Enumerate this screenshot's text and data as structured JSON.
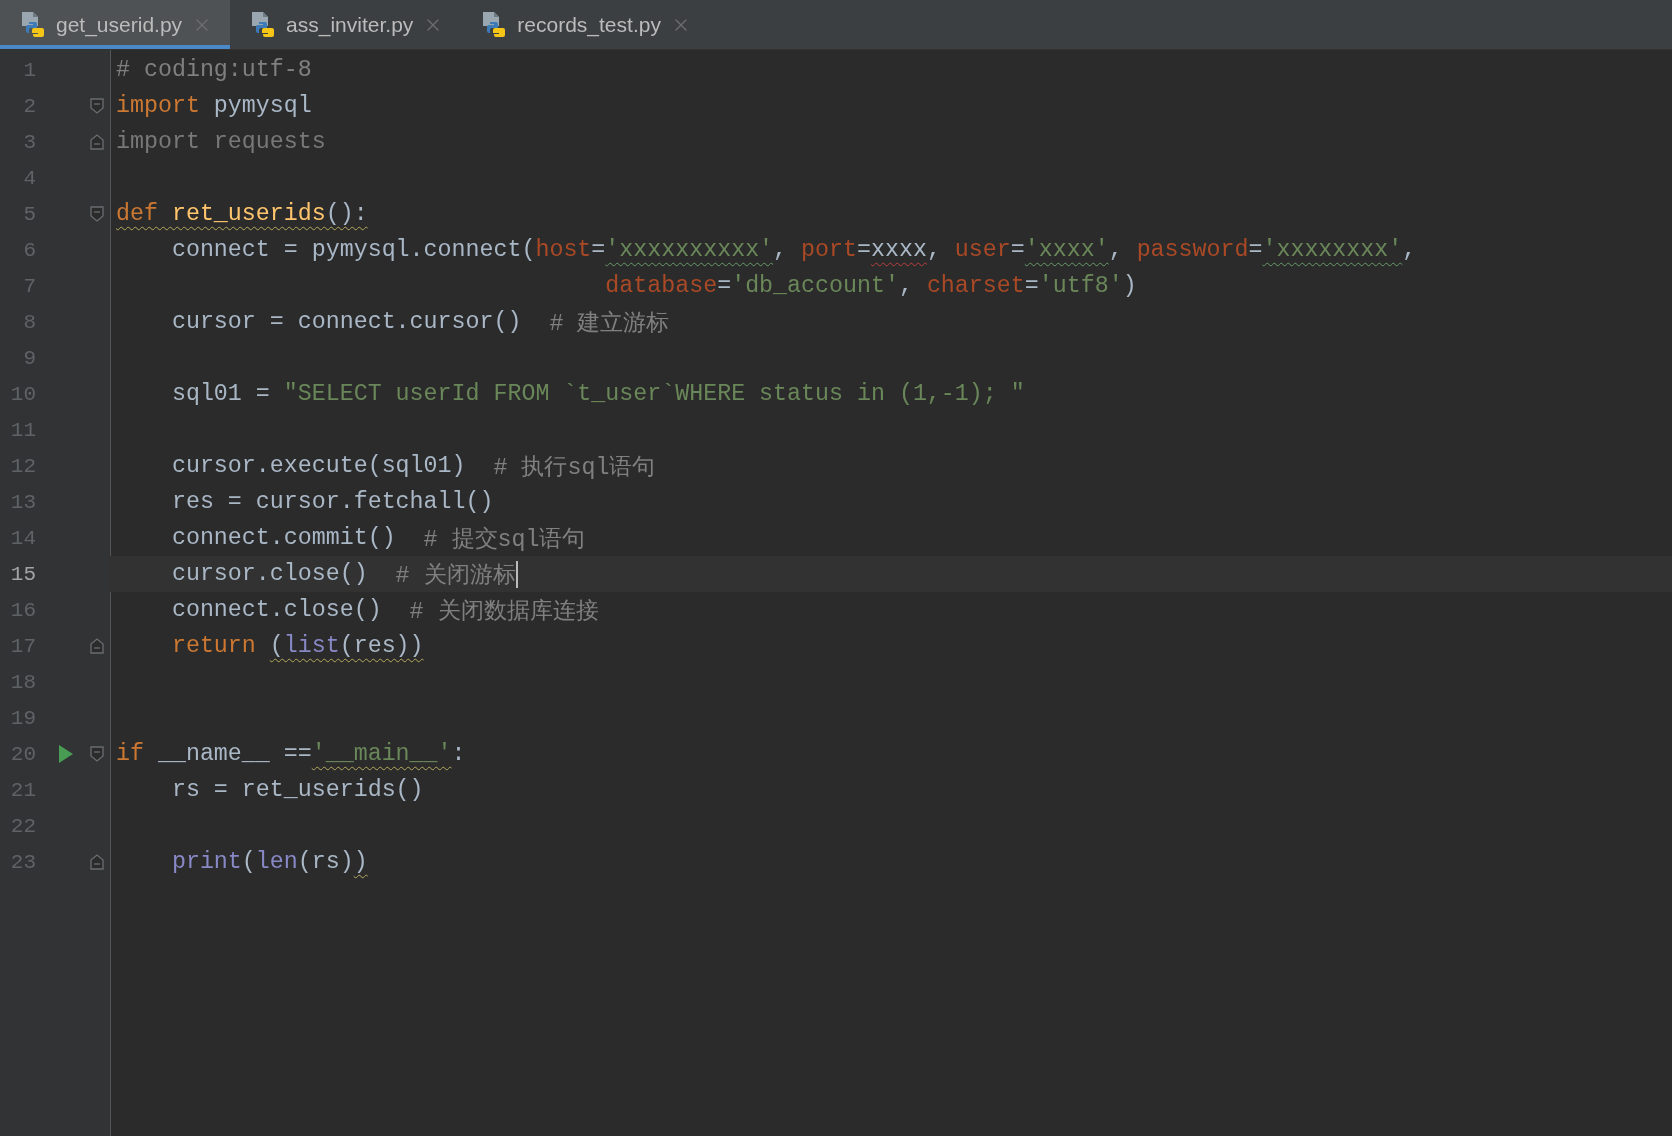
{
  "tabs": [
    {
      "label": "get_userid.py",
      "selected": true
    },
    {
      "label": "ass_inviter.py",
      "selected": false
    },
    {
      "label": "records_test.py",
      "selected": false
    }
  ],
  "editor": {
    "lines": [
      {
        "number": "1",
        "fold_start": false,
        "fold_end": false,
        "run": false,
        "current": false,
        "tokens": [
          {
            "kind": "comment",
            "text": "# coding:utf-8",
            "squiggle": false
          }
        ]
      },
      {
        "number": "2",
        "fold_start": true,
        "fold_end": false,
        "run": false,
        "current": false,
        "tokens": [
          {
            "kind": "keyword",
            "text": "import",
            "squiggle": false
          },
          {
            "kind": "plain",
            "text": " pymysql",
            "squiggle": false
          }
        ]
      },
      {
        "number": "3",
        "fold_start": false,
        "fold_end": true,
        "run": false,
        "current": false,
        "tokens": [
          {
            "kind": "unused",
            "text": "import requests",
            "squiggle": false
          }
        ]
      },
      {
        "number": "4",
        "fold_start": false,
        "fold_end": false,
        "run": false,
        "current": false
      },
      {
        "number": "5",
        "fold_start": true,
        "fold_end": false,
        "run": false,
        "current": false,
        "tokens": [
          {
            "kind": "keyword",
            "text": "def ",
            "squiggle": true
          },
          {
            "kind": "function",
            "text": "ret_userids",
            "squiggle": true
          },
          {
            "kind": "plain",
            "text": "():",
            "squiggle": true
          }
        ]
      },
      {
        "number": "6",
        "fold_start": false,
        "fold_end": false,
        "run": false,
        "current": false,
        "tokens": [
          {
            "kind": "plain",
            "text": "    connect = pymysql.connect(",
            "squiggle": false
          },
          {
            "kind": "param",
            "text": "host",
            "squiggle": false
          },
          {
            "kind": "plain",
            "text": "=",
            "squiggle": false
          },
          {
            "kind": "typo",
            "text": "'xxxxxxxxxx'",
            "squiggle": true
          },
          {
            "kind": "plain",
            "text": ", ",
            "squiggle": false
          },
          {
            "kind": "param",
            "text": "port",
            "squiggle": false
          },
          {
            "kind": "plain",
            "text": "=",
            "squiggle": false
          },
          {
            "kind": "unresolved",
            "text": "xxxx",
            "squiggle": true
          },
          {
            "kind": "plain",
            "text": ", ",
            "squiggle": false
          },
          {
            "kind": "param",
            "text": "user",
            "squiggle": false
          },
          {
            "kind": "plain",
            "text": "=",
            "squiggle": false
          },
          {
            "kind": "typo",
            "text": "'xxxx'",
            "squiggle": true
          },
          {
            "kind": "plain",
            "text": ", ",
            "squiggle": false
          },
          {
            "kind": "param",
            "text": "password",
            "squiggle": false
          },
          {
            "kind": "plain",
            "text": "=",
            "squiggle": false
          },
          {
            "kind": "typo",
            "text": "'xxxxxxxx'",
            "squiggle": true
          },
          {
            "kind": "plain",
            "text": ",",
            "squiggle": false
          }
        ]
      },
      {
        "number": "7",
        "fold_start": false,
        "fold_end": false,
        "run": false,
        "current": false,
        "tokens": [
          {
            "kind": "param",
            "text": "                                   database",
            "squiggle": false
          },
          {
            "kind": "plain",
            "text": "=",
            "squiggle": false
          },
          {
            "kind": "string",
            "text": "'db_account'",
            "squiggle": false
          },
          {
            "kind": "plain",
            "text": ", ",
            "squiggle": false
          },
          {
            "kind": "param",
            "text": "charset",
            "squiggle": false
          },
          {
            "kind": "plain",
            "text": "=",
            "squiggle": false
          },
          {
            "kind": "string",
            "text": "'utf8'",
            "squiggle": false
          },
          {
            "kind": "plain",
            "text": ")",
            "squiggle": false
          }
        ]
      },
      {
        "number": "8",
        "fold_start": false,
        "fold_end": false,
        "run": false,
        "current": false,
        "tokens": [
          {
            "kind": "plain",
            "text": "    cursor = connect.cursor()  ",
            "squiggle": false
          },
          {
            "kind": "comment",
            "text": "# 建立游标",
            "squiggle": false
          }
        ]
      },
      {
        "number": "9",
        "fold_start": false,
        "fold_end": false,
        "run": false,
        "current": false
      },
      {
        "number": "10",
        "fold_start": false,
        "fold_end": false,
        "run": false,
        "current": false,
        "tokens": [
          {
            "kind": "plain",
            "text": "    sql01 = ",
            "squiggle": false
          },
          {
            "kind": "string",
            "text": "\"SELECT userId FROM `t_user`WHERE status in (1,-1); \"",
            "squiggle": false
          }
        ]
      },
      {
        "number": "11",
        "fold_start": false,
        "fold_end": false,
        "run": false,
        "current": false
      },
      {
        "number": "12",
        "fold_start": false,
        "fold_end": false,
        "run": false,
        "current": false,
        "tokens": [
          {
            "kind": "plain",
            "text": "    cursor.execute(sql01)  ",
            "squiggle": false
          },
          {
            "kind": "comment",
            "text": "# 执行sql语句",
            "squiggle": false
          }
        ]
      },
      {
        "number": "13",
        "fold_start": false,
        "fold_end": false,
        "run": false,
        "current": false,
        "tokens": [
          {
            "kind": "plain",
            "text": "    res = cursor.fetchall()",
            "squiggle": false
          }
        ]
      },
      {
        "number": "14",
        "fold_start": false,
        "fold_end": false,
        "run": false,
        "current": false,
        "tokens": [
          {
            "kind": "plain",
            "text": "    connect.commit()  ",
            "squiggle": false
          },
          {
            "kind": "comment",
            "text": "# 提交sql语句",
            "squiggle": false
          }
        ]
      },
      {
        "number": "15",
        "fold_start": false,
        "fold_end": false,
        "run": false,
        "current": true,
        "tokens": [
          {
            "kind": "plain",
            "text": "    cursor.close()  ",
            "squiggle": false
          },
          {
            "kind": "comment",
            "text": "# 关闭游标",
            "squiggle": false
          }
        ]
      },
      {
        "number": "16",
        "fold_start": false,
        "fold_end": false,
        "run": false,
        "current": false,
        "tokens": [
          {
            "kind": "plain",
            "text": "    connect.close()  ",
            "squiggle": false
          },
          {
            "kind": "comment",
            "text": "# 关闭数据库连接",
            "squiggle": false
          }
        ]
      },
      {
        "number": "17",
        "fold_start": false,
        "fold_end": true,
        "run": false,
        "current": false,
        "tokens": [
          {
            "kind": "keyword",
            "text": "    return ",
            "squiggle": false
          },
          {
            "kind": "plain",
            "text": "(",
            "squiggle": true
          },
          {
            "kind": "builtin",
            "text": "list",
            "squiggle": true
          },
          {
            "kind": "plain",
            "text": "(res))",
            "squiggle": true
          }
        ]
      },
      {
        "number": "18",
        "fold_start": false,
        "fold_end": false,
        "run": false,
        "current": false
      },
      {
        "number": "19",
        "fold_start": false,
        "fold_end": false,
        "run": false,
        "current": false
      },
      {
        "number": "20",
        "fold_start": true,
        "fold_end": false,
        "run": true,
        "current": false,
        "tokens": [
          {
            "kind": "keyword",
            "text": "if",
            "squiggle": false
          },
          {
            "kind": "plain",
            "text": " __name__ ==",
            "squiggle": false
          },
          {
            "kind": "string",
            "text": "'__main__'",
            "squiggle": true
          },
          {
            "kind": "plain",
            "text": ":",
            "squiggle": false
          }
        ]
      },
      {
        "number": "21",
        "fold_start": false,
        "fold_end": false,
        "run": false,
        "current": false,
        "tokens": [
          {
            "kind": "plain",
            "text": "    rs = ret_userids()",
            "squiggle": false
          }
        ]
      },
      {
        "number": "22",
        "fold_start": false,
        "fold_end": false,
        "run": false,
        "current": false
      },
      {
        "number": "23",
        "fold_start": false,
        "fold_end": true,
        "run": false,
        "current": false,
        "tokens": [
          {
            "kind": "builtin",
            "text": "    print",
            "squiggle": false
          },
          {
            "kind": "plain",
            "text": "(",
            "squiggle": false
          },
          {
            "kind": "builtin",
            "text": "len",
            "squiggle": false
          },
          {
            "kind": "plain",
            "text": "(rs)",
            "squiggle": false
          },
          {
            "kind": "plain",
            "text": ")",
            "squiggle": true
          }
        ]
      }
    ]
  }
}
